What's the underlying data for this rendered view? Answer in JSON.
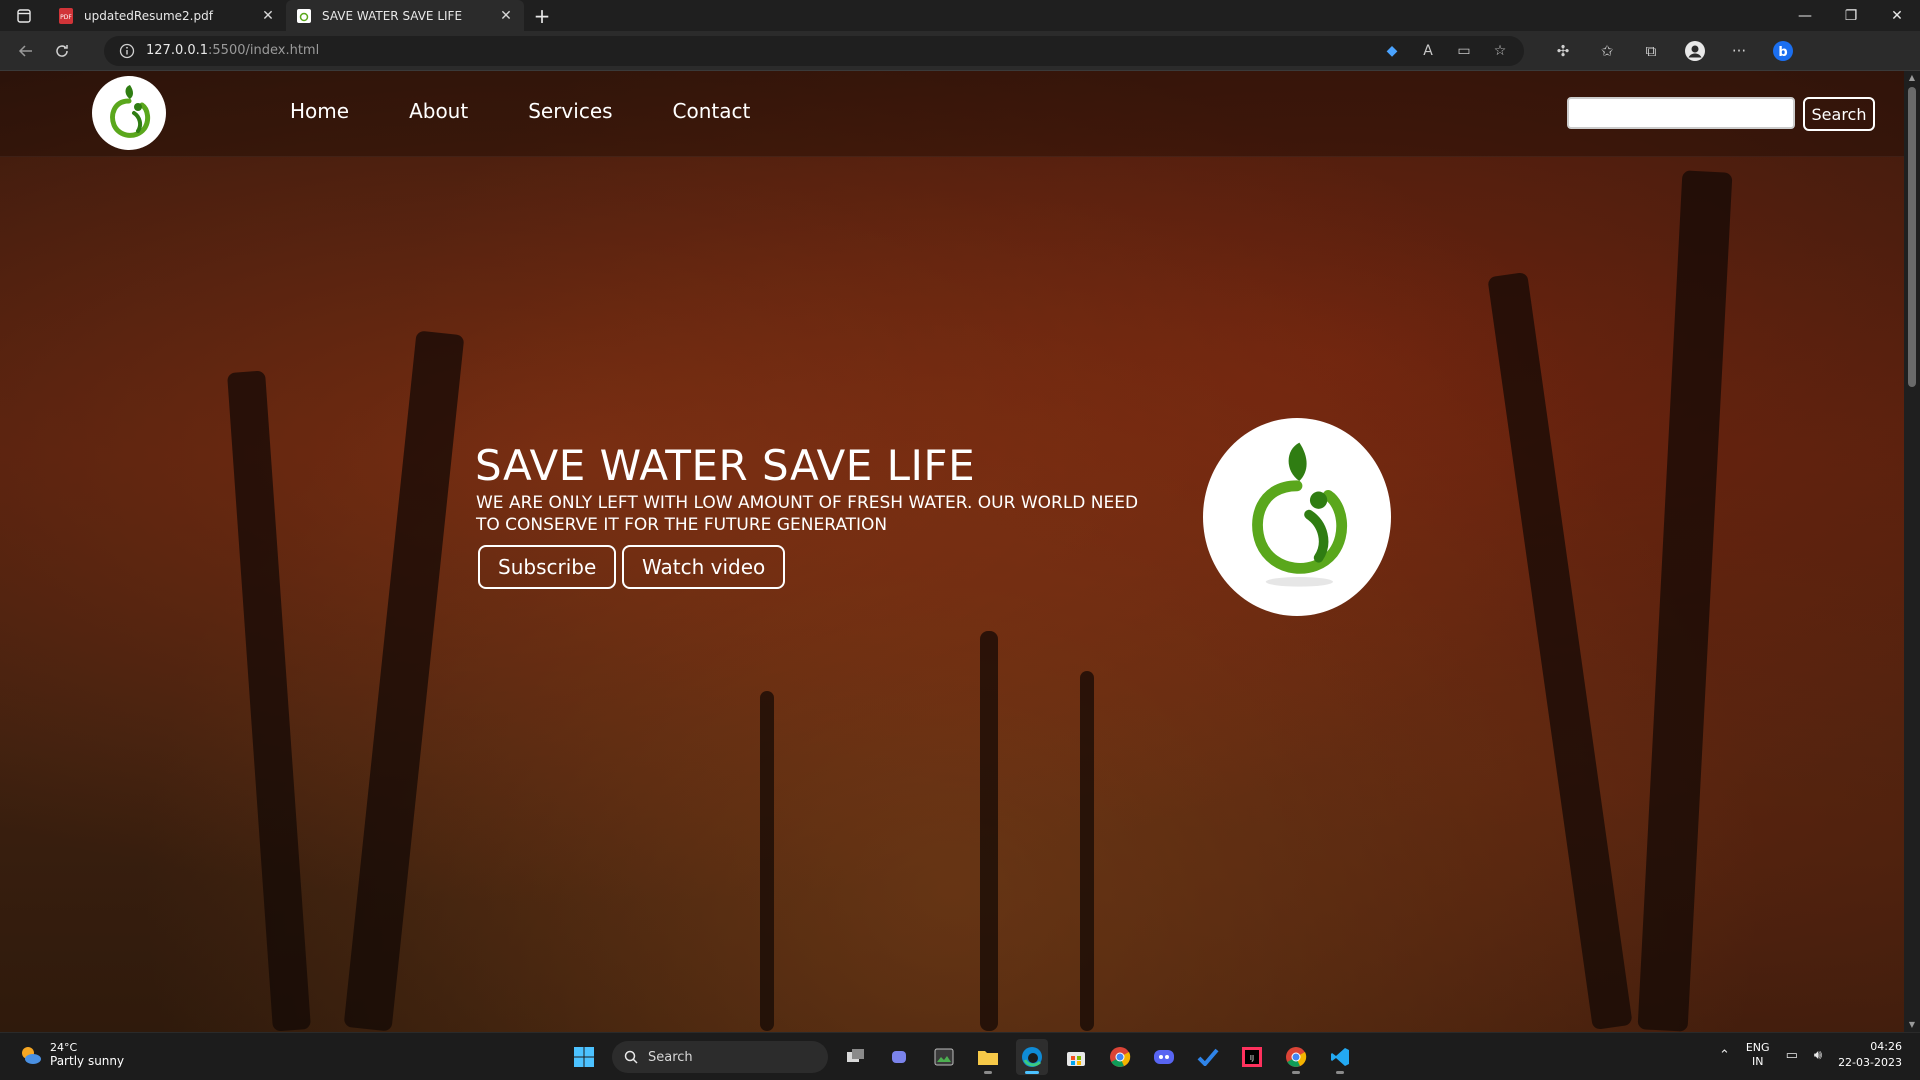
{
  "browser": {
    "tabs": [
      {
        "title": "updatedResume2.pdf",
        "icon": "pdf-icon",
        "active": false
      },
      {
        "title": "SAVE WATER SAVE LIFE",
        "icon": "page-icon",
        "active": true
      }
    ],
    "url_host": "127.0.0.1",
    "url_path": ":5500/index.html"
  },
  "site": {
    "nav": [
      "Home",
      "About",
      "Services",
      "Contact"
    ],
    "search_placeholder": "",
    "search_button": "Search",
    "hero": {
      "title": "SAVE WATER SAVE LIFE",
      "subtitle": "WE ARE ONLY LEFT WITH LOW AMOUNT OF FRESH WATER. OUR WORLD NEED TO CONSERVE IT FOR THE FUTURE GENERATION",
      "subscribe": "Subscribe",
      "watch": "Watch video"
    }
  },
  "taskbar": {
    "weather_temp": "24°C",
    "weather_cond": "Partly sunny",
    "search_label": "Search",
    "lang_top": "ENG",
    "lang_bottom": "IN",
    "time": "04:26",
    "date": "22-03-2023"
  },
  "colors": {
    "logo_green": "#5aa71c",
    "logo_dark_green": "#2f7d12"
  }
}
